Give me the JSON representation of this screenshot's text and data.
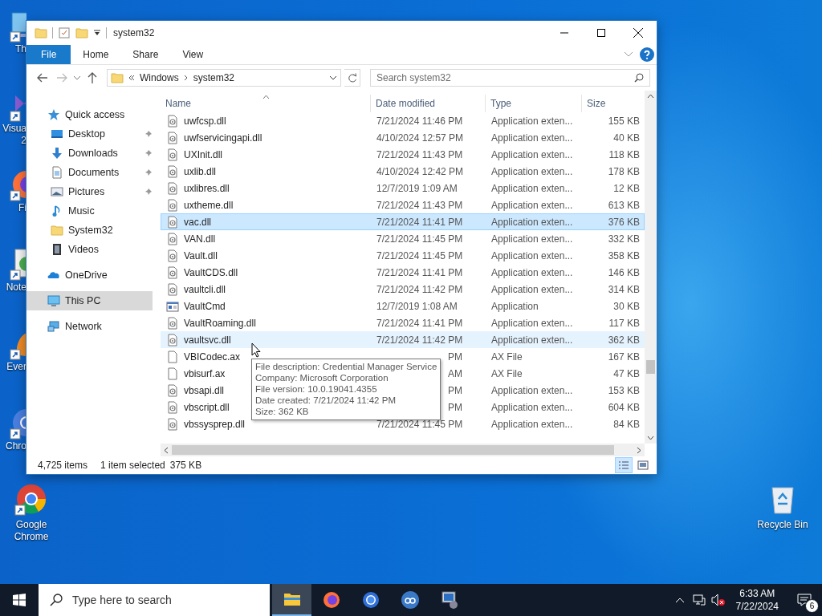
{
  "desktop": {
    "icons_behind_window": [
      {
        "kind": "pc",
        "lines": [
          "Th"
        ]
      },
      {
        "kind": "visual-studio",
        "lines": [
          "Visua",
          "2"
        ]
      },
      {
        "kind": "firefox",
        "lines": [
          "Fi"
        ]
      },
      {
        "kind": "notepad",
        "lines": [
          "Note"
        ]
      },
      {
        "kind": "evernote",
        "lines": [
          "Ever"
        ]
      },
      {
        "kind": "chromium",
        "lines": [
          "Chro"
        ]
      }
    ],
    "left_icons": [
      {
        "kind": "chrome",
        "lines": [
          "Google",
          "Chrome"
        ]
      }
    ],
    "right_icons": [
      {
        "kind": "recycle-bin",
        "lines": [
          "Recycle Bin"
        ]
      }
    ]
  },
  "window": {
    "title": "system32",
    "ribbon_tabs": [
      {
        "label": "File",
        "kind": "file"
      },
      {
        "label": "Home",
        "kind": "tab"
      },
      {
        "label": "Share",
        "kind": "tab"
      },
      {
        "label": "View",
        "kind": "tab"
      }
    ],
    "address": {
      "path": [
        "Windows",
        "system32"
      ],
      "search_placeholder": "Search system32"
    },
    "sidebar": {
      "items": [
        {
          "label": "Quick access",
          "kind": "star",
          "selected": false,
          "children": [
            {
              "label": "Desktop",
              "kind": "desktop",
              "pinned": true,
              "selected": false
            },
            {
              "label": "Downloads",
              "kind": "downloads",
              "pinned": true,
              "selected": false
            },
            {
              "label": "Documents",
              "kind": "documents",
              "pinned": true,
              "selected": false
            },
            {
              "label": "Pictures",
              "kind": "pictures",
              "pinned": true,
              "selected": false
            },
            {
              "label": "Music",
              "kind": "music",
              "pinned": false,
              "selected": false
            },
            {
              "label": "System32",
              "kind": "folder",
              "pinned": false,
              "selected": false
            },
            {
              "label": "Videos",
              "kind": "videos",
              "pinned": false,
              "selected": false
            }
          ]
        },
        {
          "label": "OneDrive",
          "kind": "onedrive",
          "selected": false
        },
        {
          "label": "This PC",
          "kind": "pc",
          "selected": true
        },
        {
          "label": "Network",
          "kind": "network",
          "selected": false
        }
      ]
    },
    "columns": [
      {
        "label": "Name",
        "sorted": true
      },
      {
        "label": "Date modified",
        "sorted": false
      },
      {
        "label": "Type",
        "sorted": false
      },
      {
        "label": "Size",
        "sorted": false
      }
    ],
    "rows": [
      {
        "kind": "dll",
        "name": "uwfcsp.dll",
        "date": "7/21/2024 11:46 PM",
        "type": "Application exten...",
        "size": "155 KB",
        "selected": false,
        "hovered": false
      },
      {
        "kind": "dll",
        "name": "uwfservicingapi.dll",
        "date": "4/10/2024 12:57 PM",
        "type": "Application exten...",
        "size": "40 KB",
        "selected": false,
        "hovered": false
      },
      {
        "kind": "dll",
        "name": "UXInit.dll",
        "date": "7/21/2024 11:43 PM",
        "type": "Application exten...",
        "size": "118 KB",
        "selected": false,
        "hovered": false
      },
      {
        "kind": "dll",
        "name": "uxlib.dll",
        "date": "4/10/2024 12:42 PM",
        "type": "Application exten...",
        "size": "178 KB",
        "selected": false,
        "hovered": false
      },
      {
        "kind": "dll",
        "name": "uxlibres.dll",
        "date": "12/7/2019 1:09 AM",
        "type": "Application exten...",
        "size": "12 KB",
        "selected": false,
        "hovered": false
      },
      {
        "kind": "dll",
        "name": "uxtheme.dll",
        "date": "7/21/2024 11:43 PM",
        "type": "Application exten...",
        "size": "613 KB",
        "selected": false,
        "hovered": false
      },
      {
        "kind": "dll",
        "name": "vac.dll",
        "date": "7/21/2024 11:41 PM",
        "type": "Application exten...",
        "size": "376 KB",
        "selected": true,
        "hovered": false
      },
      {
        "kind": "dll",
        "name": "VAN.dll",
        "date": "7/21/2024 11:45 PM",
        "type": "Application exten...",
        "size": "332 KB",
        "selected": false,
        "hovered": false
      },
      {
        "kind": "dll",
        "name": "Vault.dll",
        "date": "7/21/2024 11:45 PM",
        "type": "Application exten...",
        "size": "358 KB",
        "selected": false,
        "hovered": false
      },
      {
        "kind": "dll",
        "name": "VaultCDS.dll",
        "date": "7/21/2024 11:41 PM",
        "type": "Application exten...",
        "size": "146 KB",
        "selected": false,
        "hovered": false
      },
      {
        "kind": "dll",
        "name": "vaultcli.dll",
        "date": "7/21/2024 11:42 PM",
        "type": "Application exten...",
        "size": "314 KB",
        "selected": false,
        "hovered": false
      },
      {
        "kind": "app",
        "name": "VaultCmd",
        "date": "12/7/2019 1:08 AM",
        "type": "Application",
        "size": "30 KB",
        "selected": false,
        "hovered": false
      },
      {
        "kind": "dll",
        "name": "VaultRoaming.dll",
        "date": "7/21/2024 11:41 PM",
        "type": "Application exten...",
        "size": "117 KB",
        "selected": false,
        "hovered": false
      },
      {
        "kind": "dll",
        "name": "vaultsvc.dll",
        "date": "7/21/2024 11:42 PM",
        "type": "Application exten...",
        "size": "362 KB",
        "selected": false,
        "hovered": true
      },
      {
        "kind": "ax",
        "name": "VBICodec.ax",
        "date_end": "PM",
        "type": "AX File",
        "size": "167 KB",
        "selected": false,
        "hovered": false
      },
      {
        "kind": "ax",
        "name": "vbisurf.ax",
        "date_end": "AM",
        "type": "AX File",
        "size": "47 KB",
        "selected": false,
        "hovered": false
      },
      {
        "kind": "dll",
        "name": "vbsapi.dll",
        "date_end": "PM",
        "type": "Application exten...",
        "size": "153 KB",
        "selected": false,
        "hovered": false
      },
      {
        "kind": "dll",
        "name": "vbscript.dll",
        "date_end": "PM",
        "type": "Application exten...",
        "size": "604 KB",
        "selected": false,
        "hovered": false
      },
      {
        "kind": "dll",
        "name": "vbssysprep.dll",
        "date": "7/21/2024 11:45 PM",
        "type": "Application exten...",
        "size": "84 KB",
        "selected": false,
        "hovered": false
      }
    ],
    "tooltip": {
      "lines": [
        "File description: Credential Manager Service",
        "Company: Microsoft Corporation",
        "File version: 10.0.19041.4355",
        "Date created: 7/21/2024 11:42 PM",
        "Size: 362 KB"
      ]
    },
    "status_bar": {
      "item_count": "4,725 items",
      "selection": "1 item selected",
      "selection_size": "375 KB",
      "views": [
        {
          "kind": "details",
          "selected": true
        },
        {
          "kind": "large-icons",
          "selected": false
        }
      ]
    }
  },
  "taskbar": {
    "search_placeholder": "Type here to search",
    "apps": [
      {
        "kind": "file-explorer",
        "active": true
      },
      {
        "kind": "firefox",
        "active": false
      },
      {
        "kind": "chromium",
        "active": false
      },
      {
        "kind": "qbittorrent",
        "active": false
      },
      {
        "kind": "network-computer",
        "active": false
      }
    ],
    "clock": {
      "time": "6:33 AM",
      "date": "7/22/2024"
    },
    "notifications": "6"
  }
}
